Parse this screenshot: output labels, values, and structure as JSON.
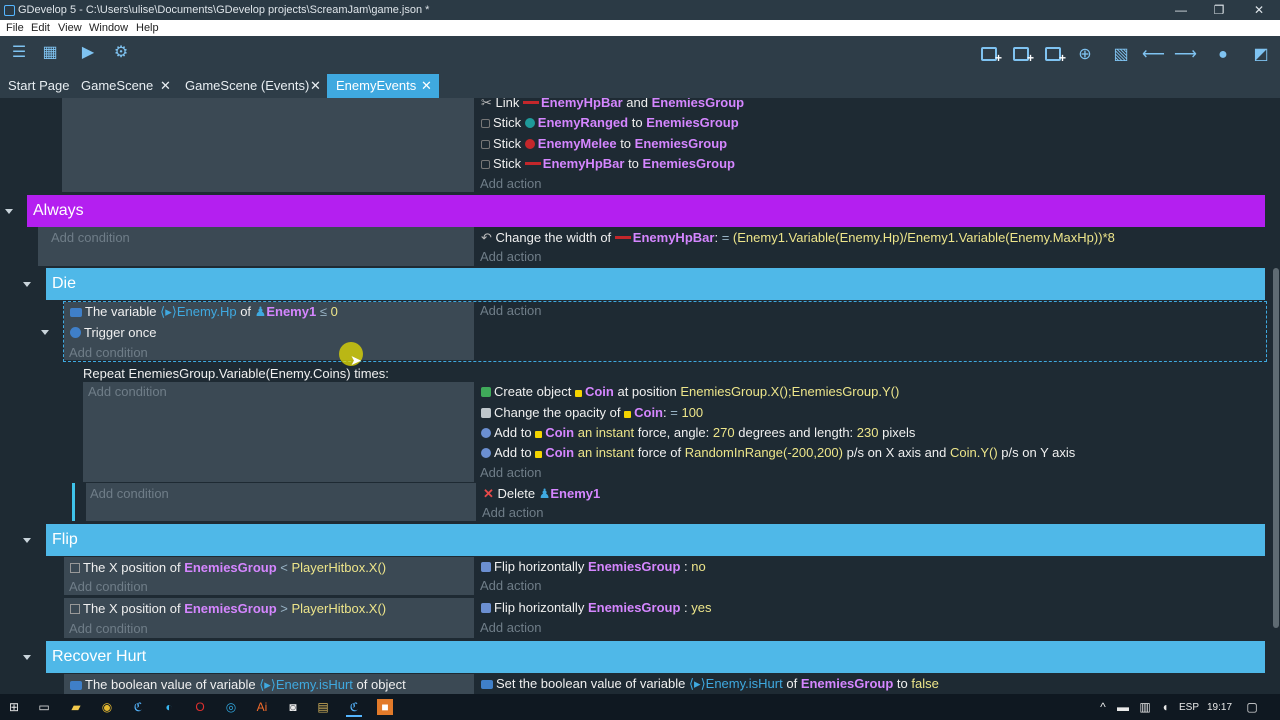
{
  "window": {
    "title": "GDevelop 5 - C:\\Users\\ulise\\Documents\\GDevelop projects\\ScreamJam\\game.json *",
    "minimize": "—",
    "restore": "❐",
    "close": "✕"
  },
  "menu": {
    "file": "File",
    "edit": "Edit",
    "view": "View",
    "window": "Window",
    "help": "Help"
  },
  "tabs": [
    {
      "label": "Start Page"
    },
    {
      "label": "GameScene",
      "close": "✕"
    },
    {
      "label": "GameScene (Events)",
      "close": "✕"
    },
    {
      "label": "EnemyEvents",
      "close": "✕"
    }
  ],
  "events": {
    "top_actions": {
      "a1_verb": "Link",
      "a1_obj1": "EnemyHpBar",
      "a1_and": "and",
      "a1_obj2": "EnemiesGroup",
      "a2_verb": "Stick",
      "a2_obj1": "EnemyRanged",
      "a2_to": "to",
      "a2_obj2": "EnemiesGroup",
      "a3_verb": "Stick",
      "a3_obj1": "EnemyMelee",
      "a3_to": "to",
      "a3_obj2": "EnemiesGroup",
      "a4_verb": "Stick",
      "a4_obj1": "EnemyHpBar",
      "a4_to": "to",
      "a4_obj2": "EnemiesGroup"
    },
    "add_action": "Add action",
    "add_condition": "Add condition",
    "always": {
      "title": "Always",
      "action_prefix": "Change the width of",
      "action_obj": "EnemyHpBar",
      "action_colon": ":",
      "action_op": "=",
      "action_expr": "(Enemy1.Variable(Enemy.Hp)/Enemy1.Variable(Enemy.MaxHp))*8"
    },
    "die": {
      "title": "Die",
      "c1_prefix": "The variable",
      "c1_var": "Enemy.Hp",
      "c1_of": "of",
      "c1_obj": "Enemy1",
      "c1_op": "≤",
      "c1_val": "0",
      "c2": "Trigger once",
      "repeat": "Repeat EnemiesGroup.Variable(Enemy.Coins) times:",
      "r_a1_prefix": "Create object",
      "r_a1_obj": "Coin",
      "r_a1_mid": "at position",
      "r_a1_expr": "EnemiesGroup.X();EnemiesGroup.Y()",
      "r_a2_prefix": "Change the opacity of",
      "r_a2_obj": "Coin",
      "r_a2_colon": ":",
      "r_a2_op": "=",
      "r_a2_val": "100",
      "r_a3_prefix": "Add to",
      "r_a3_obj": "Coin",
      "r_a3_inst": "an instant",
      "r_a3_mid": "force, angle:",
      "r_a3_angle": "270",
      "r_a3_mid2": "degrees and length:",
      "r_a3_len": "230",
      "r_a3_unit": "pixels",
      "r_a4_prefix": "Add to",
      "r_a4_obj": "Coin",
      "r_a4_inst": "an instant",
      "r_a4_mid": "force of",
      "r_a4_x": "RandomInRange(-200,200)",
      "r_a4_mid2": "p/s on X axis and",
      "r_a4_y": "Coin.Y()",
      "r_a4_unit": "p/s on Y axis",
      "d_verb": "Delete",
      "d_obj": "Enemy1"
    },
    "flip": {
      "title": "Flip",
      "c1_prefix": "The X position of",
      "c1_obj": "EnemiesGroup",
      "c1_op": "<",
      "c1_expr": "PlayerHitbox.X()",
      "a1_prefix": "Flip horizontally",
      "a1_obj": "EnemiesGroup",
      "a1_colon": ":",
      "a1_val": "no",
      "c2_prefix": "The X position of",
      "c2_obj": "EnemiesGroup",
      "c2_op": ">",
      "c2_expr": "PlayerHitbox.X()",
      "a2_prefix": "Flip horizontally",
      "a2_obj": "EnemiesGroup",
      "a2_colon": ":",
      "a2_val": "yes"
    },
    "recover": {
      "title": "Recover Hurt",
      "c1_prefix": "The boolean value of variable",
      "c1_var": "Enemy.isHurt",
      "c1_of": "of object",
      "a1_prefix": "Set the boolean value of variable",
      "a1_var": "Enemy.isHurt",
      "a1_of": "of",
      "a1_obj": "EnemiesGroup",
      "a1_to": "to",
      "a1_val": "false"
    }
  },
  "taskbar": {
    "lang": "ESP",
    "time": "19:17"
  },
  "colors": {
    "group_bar": "#4fb8e8",
    "always_bar": "#b41ff0",
    "object": "#d586ff",
    "value": "#ede58a",
    "variable": "#3fa9e0"
  }
}
